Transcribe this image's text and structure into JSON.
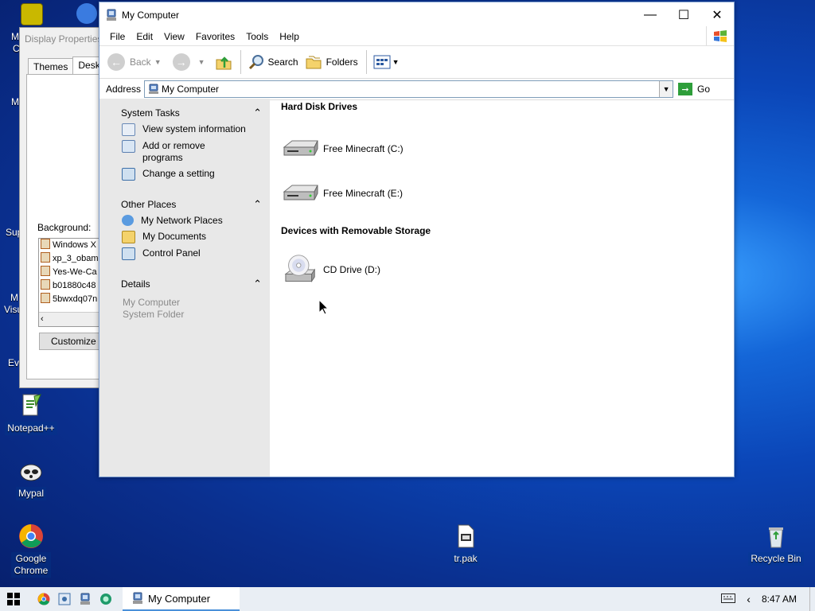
{
  "desktop": {
    "icons": [
      {
        "label": "Notepad++",
        "icon": "notepadpp-icon"
      },
      {
        "label": "Mypal",
        "icon": "mypal-icon"
      },
      {
        "label": "Google Chrome",
        "icon": "chrome-icon"
      },
      {
        "label": "tr.pak",
        "icon": "file-icon"
      },
      {
        "label": "Recycle Bin",
        "icon": "recycle-bin-icon"
      }
    ],
    "edge_labels": [
      "M",
      "C",
      "M",
      "Sup",
      "M",
      "Visu",
      "Ev"
    ]
  },
  "display_properties": {
    "title": "Display Properties",
    "tabs": [
      "Themes",
      "Desktop"
    ],
    "background_label": "Background:",
    "background_items": [
      "Windows X",
      "xp_3_obam",
      "Yes-We-Ca",
      "b01880c48",
      "5bwxdq07n"
    ],
    "customize_label": "Customize De"
  },
  "window": {
    "title": "My Computer",
    "menu": [
      "File",
      "Edit",
      "View",
      "Favorites",
      "Tools",
      "Help"
    ],
    "toolbar": {
      "back": "Back",
      "search": "Search",
      "folders": "Folders"
    },
    "address": {
      "label": "Address",
      "value": "My Computer",
      "go": "Go"
    },
    "task_pane": {
      "system_tasks": {
        "title": "System Tasks",
        "items": [
          "View system information",
          "Add or remove programs",
          "Change a setting"
        ]
      },
      "other_places": {
        "title": "Other Places",
        "items": [
          "My Network Places",
          "My Documents",
          "Control Panel"
        ]
      },
      "details": {
        "title": "Details",
        "line1": "My Computer",
        "line2": "System Folder"
      }
    },
    "groups": {
      "hdd": {
        "title": "Hard Disk Drives",
        "drives": [
          "Free Minecraft (C:)",
          "Free Minecraft (E:)"
        ]
      },
      "removable": {
        "title": "Devices with Removable Storage",
        "drives": [
          "CD Drive (D:)"
        ]
      }
    }
  },
  "taskbar": {
    "task": "My Computer",
    "time": "8:47 AM"
  }
}
